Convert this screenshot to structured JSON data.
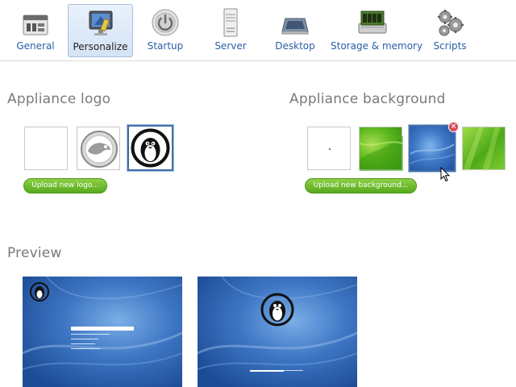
{
  "toolbar": {
    "items": [
      {
        "label": "General",
        "icon": "control-panel-icon"
      },
      {
        "label": "Personalize",
        "icon": "personalize-monitor-icon",
        "active": true
      },
      {
        "label": "Startup",
        "icon": "power-icon"
      },
      {
        "label": "Server",
        "icon": "server-tower-icon"
      },
      {
        "label": "Desktop",
        "icon": "desktop-icon"
      },
      {
        "label": "Storage & memory",
        "icon": "memory-chip-icon"
      },
      {
        "label": "Scripts",
        "icon": "gears-icon"
      }
    ]
  },
  "logo_section": {
    "title": "Appliance logo",
    "thumbnails": [
      {
        "name": "none"
      },
      {
        "name": "opensuse-gecko"
      },
      {
        "name": "tux-penguin",
        "selected": true
      }
    ],
    "upload_label": "Upload new logo..."
  },
  "background_section": {
    "title": "Appliance background",
    "thumbnails": [
      {
        "name": "blank"
      },
      {
        "name": "green-1"
      },
      {
        "name": "blue",
        "selected": true,
        "deletable": true
      },
      {
        "name": "green-2"
      }
    ],
    "delete_glyph": "×",
    "upload_label": "Upload new background..."
  },
  "preview_section": {
    "title": "Preview"
  },
  "colors": {
    "accent_blue": "#2a5ea8",
    "button_green": "#57a91c",
    "title_gray": "#7a7a7a",
    "delete_red": "#d84b5a"
  }
}
